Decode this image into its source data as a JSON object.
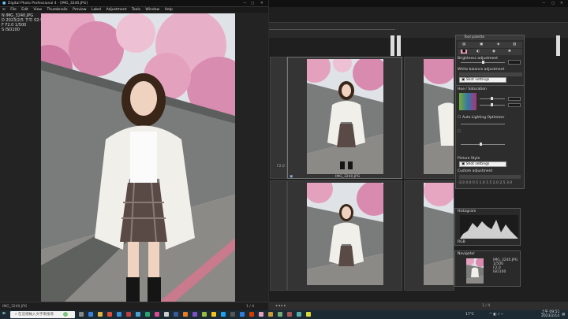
{
  "window_left": {
    "title": "Digital Photo Professional 4 - [IMG_3240.JPG]",
    "menu": [
      "File",
      "Edit",
      "View",
      "Thumbnails",
      "Preview",
      "Label",
      "Adjustment",
      "Tools",
      "Window",
      "Help"
    ],
    "info_lines": [
      "IMG_3240.JPG",
      "2023/2/5 下午 02:53:17",
      "F2.0 1/500",
      "ISO100"
    ],
    "info_prefixes": [
      "N",
      "D",
      "F",
      "S"
    ]
  },
  "window_right": {
    "thumbnails": [
      {
        "filename": "IMG_3240.JPG"
      },
      {
        "filename": ""
      },
      {
        "filename": ""
      },
      {
        "filename": ""
      }
    ]
  },
  "palette": {
    "title": "Tool palette",
    "brightness_label": "Brightness adjustment",
    "wb_label": "White balance adjustment",
    "wb_select": "Shot settings",
    "rgb_label": "Hue / Saturation",
    "auto_lighting": "Auto Lighting Optimizer",
    "picture_style_label": "Picture Style",
    "picture_style_select": "Shot settings",
    "custom_label": "Custom adjustment",
    "scale": [
      "-1/3",
      "0.0",
      "0.5",
      "1.0",
      "1.5",
      "2.0",
      "2.5",
      "3.0",
      "3.5",
      "4.0"
    ]
  },
  "histogram": {
    "title": "Histogram",
    "stat": "RGB"
  },
  "navigator": {
    "title": "Navigator",
    "info": [
      "IMG_3240.JPG",
      "1/500",
      "F2.0",
      "ISO100"
    ]
  },
  "status": {
    "left": "IMG_3240.JPG",
    "right": "1 / 4"
  },
  "taskbar": {
    "search_placeholder": "在這裡輸入文字來搜尋",
    "temperature": "17°C",
    "time": "上午 09:51",
    "date": "2023/2/14"
  },
  "colors": {
    "accent_pink": "#e8a0c0",
    "sky": "#dfe3e8"
  }
}
